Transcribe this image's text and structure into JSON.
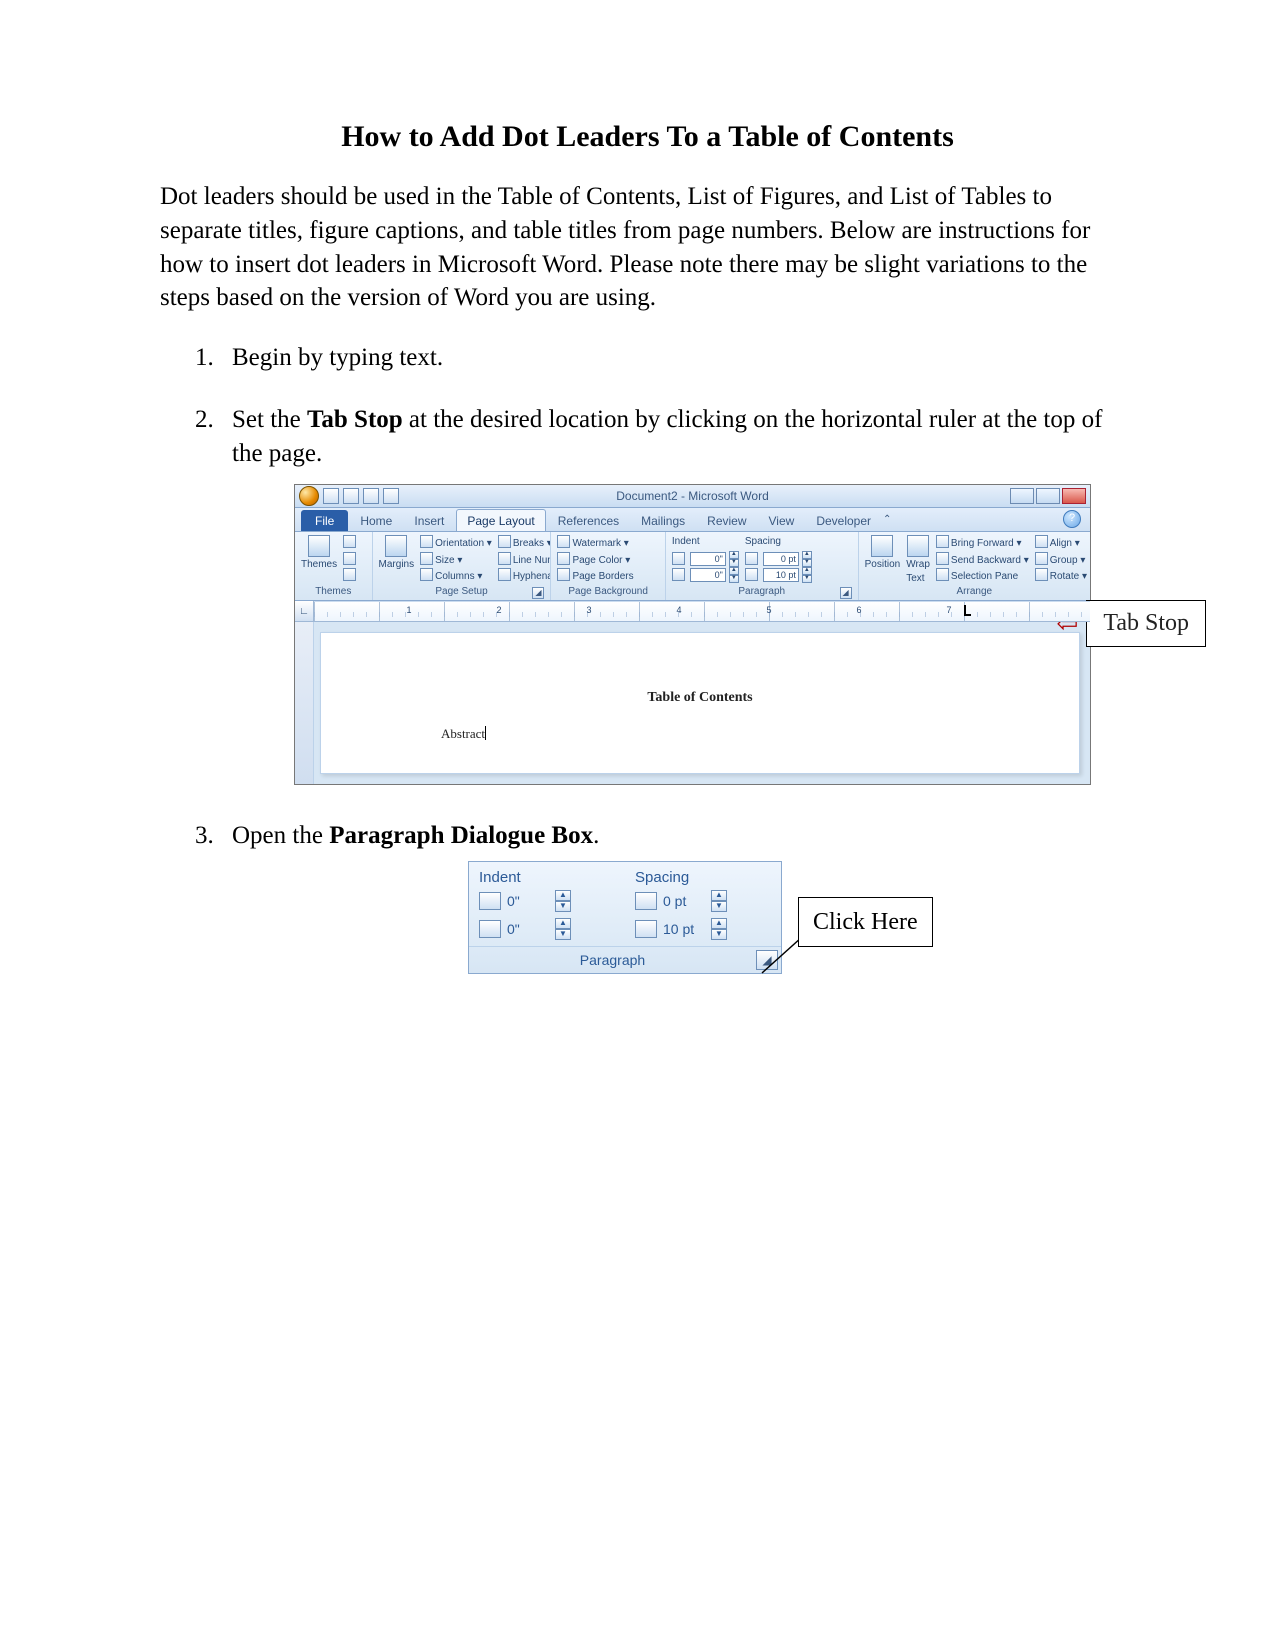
{
  "title": "How to Add Dot Leaders To a Table of Contents",
  "intro": "Dot leaders should be used in the Table of Contents, List of Figures, and List of Tables to separate titles, figure captions, and table titles from page numbers. Below are instructions for how to insert dot leaders in Microsoft Word. Please note there may be slight variations to the steps based on the version of Word you are using.",
  "steps": {
    "s1": "Begin by typing text.",
    "s2_pre": "Set the ",
    "s2_b": "Tab Stop",
    "s2_post": " at the desired location by clicking on the horizontal ruler at the top of the page.",
    "s3_pre": "Open the ",
    "s3_b": "Paragraph Dialogue Box",
    "s3_post": "."
  },
  "callouts": {
    "tabstop": "Tab Stop",
    "clickhere": "Click Here"
  },
  "word": {
    "title": "Document2 - Microsoft Word",
    "tabs": {
      "file": "File",
      "home": "Home",
      "insert": "Insert",
      "pagelayout": "Page Layout",
      "references": "References",
      "mailings": "Mailings",
      "review": "Review",
      "view": "View",
      "developer": "Developer"
    },
    "groups": {
      "themes": {
        "label": "Themes",
        "btn": "Themes"
      },
      "pagesetup": {
        "label": "Page Setup",
        "margins": "Margins",
        "orientation": "Orientation ▾",
        "size": "Size ▾",
        "columns": "Columns ▾",
        "breaks": "Breaks ▾",
        "linenumbers": "Line Numbers ▾",
        "hyphenation": "Hyphenation ▾"
      },
      "pagebg": {
        "label": "Page Background",
        "watermark": "Watermark ▾",
        "pagecolor": "Page Color ▾",
        "pageborders": "Page Borders"
      },
      "paragraph": {
        "label": "Paragraph",
        "indent": "Indent",
        "spacing": "Spacing",
        "left": "0\"",
        "right": "0\"",
        "before": "0 pt",
        "after": "10 pt"
      },
      "arrange": {
        "label": "Arrange",
        "position": "Position",
        "wrap": "Wrap Text",
        "bringfwd": "Bring Forward ▾",
        "sendback": "Send Backward ▾",
        "selection": "Selection Pane",
        "align": "Align ▾",
        "group": "Group ▾",
        "rotate": "Rotate ▾"
      }
    },
    "ruler_numbers": [
      "1",
      "2",
      "3",
      "4",
      "5",
      "6",
      "7"
    ],
    "doc": {
      "toc_title": "Table of Contents",
      "line1": "Abstract"
    }
  },
  "para_panel": {
    "indent": "Indent",
    "spacing": "Spacing",
    "left": "0\"",
    "right": "0\"",
    "before": "0 pt",
    "after": "10 pt",
    "footer": "Paragraph"
  }
}
